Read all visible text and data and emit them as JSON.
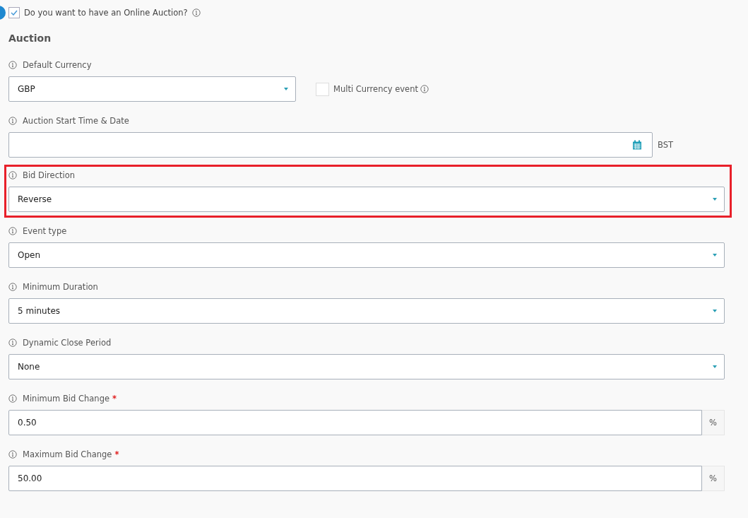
{
  "online_auction": {
    "label": "Do you want to have an Online Auction?",
    "checked": true
  },
  "section_title": "Auction",
  "fields": [
    {
      "kind": "select",
      "label": "Default Currency",
      "value": "GBP",
      "highlighted": false,
      "extra": {
        "label": "Multi Currency event",
        "checked": false
      }
    },
    {
      "kind": "date",
      "label": "Auction Start Time & Date",
      "highlighted": false,
      "suffix": "BST"
    },
    {
      "kind": "select",
      "label": "Bid Direction",
      "value": "Reverse",
      "highlighted": true
    },
    {
      "kind": "select",
      "label": "Event type",
      "value": "Open",
      "highlighted": false
    },
    {
      "kind": "select",
      "label": "Minimum Duration",
      "value": "5 minutes",
      "highlighted": false
    },
    {
      "kind": "select",
      "label": "Dynamic Close Period",
      "value": "None",
      "highlighted": false
    },
    {
      "kind": "percent",
      "label": "Minimum Bid Change",
      "value": "0.50",
      "required_mark": "*",
      "highlighted": false,
      "addon": "%"
    },
    {
      "kind": "percent",
      "label": "Maximum Bid Change",
      "value": "50.00",
      "required_mark": "*",
      "highlighted": false,
      "addon": "%"
    }
  ]
}
